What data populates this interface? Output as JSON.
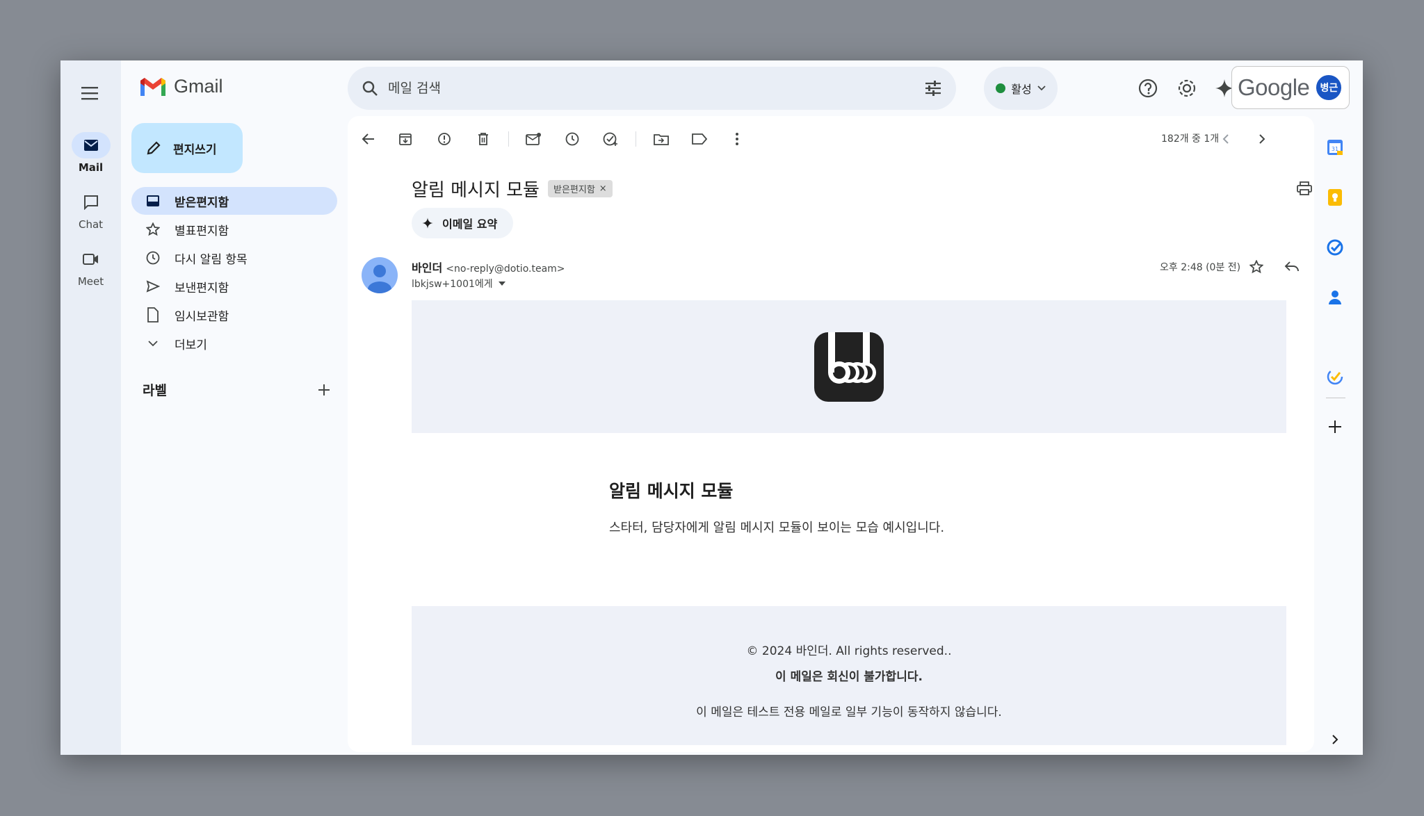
{
  "app": {
    "name": "Gmail"
  },
  "rail": [
    {
      "label": "Mail",
      "active": true
    },
    {
      "label": "Chat",
      "active": false
    },
    {
      "label": "Meet",
      "active": false
    }
  ],
  "search": {
    "placeholder": "메일 검색"
  },
  "status": {
    "label": "활성",
    "color": "#1e8e3e"
  },
  "account": {
    "brand": "Google",
    "avatar_text": "병근"
  },
  "compose": {
    "label": "편지쓰기"
  },
  "nav": [
    {
      "label": "받은편지함",
      "icon": "inbox-icon",
      "active": true
    },
    {
      "label": "별표편지함",
      "icon": "star-icon",
      "active": false
    },
    {
      "label": "다시 알림 항목",
      "icon": "clock-icon",
      "active": false
    },
    {
      "label": "보낸편지함",
      "icon": "send-icon",
      "active": false
    },
    {
      "label": "임시보관함",
      "icon": "draft-icon",
      "active": false
    },
    {
      "label": "더보기",
      "icon": "chevron-down-icon",
      "active": false
    }
  ],
  "labels": {
    "heading": "라벨"
  },
  "toolbar": {
    "pager": "182개 중 1개"
  },
  "message": {
    "subject": "알림 메시지 모듈",
    "folder_chip": "받은편지함",
    "summary_button": "이메일 요약",
    "sender_name": "바인더",
    "sender_address": "<no-reply@dotio.team>",
    "recipient": "lbkjsw+1001에게",
    "time": "오후 2:48 (0분 전)"
  },
  "email": {
    "title": "알림 메시지 모듈",
    "body": "스타터, 담당자에게 알림 메시지 모듈이 보이는 모습 예시입니다.",
    "footer_copyright": "© 2024 바인더. All rights reserved..",
    "footer_noreply": "이 메일은 회신이 불가합니다.",
    "footer_note": "이 메일은 테스트 전용 메일로 일부 기능이 동작하지 않습니다."
  },
  "colors": {
    "accent": "#0b57d0",
    "active_nav": "#d3e3fd",
    "compose": "#c2e7ff"
  }
}
